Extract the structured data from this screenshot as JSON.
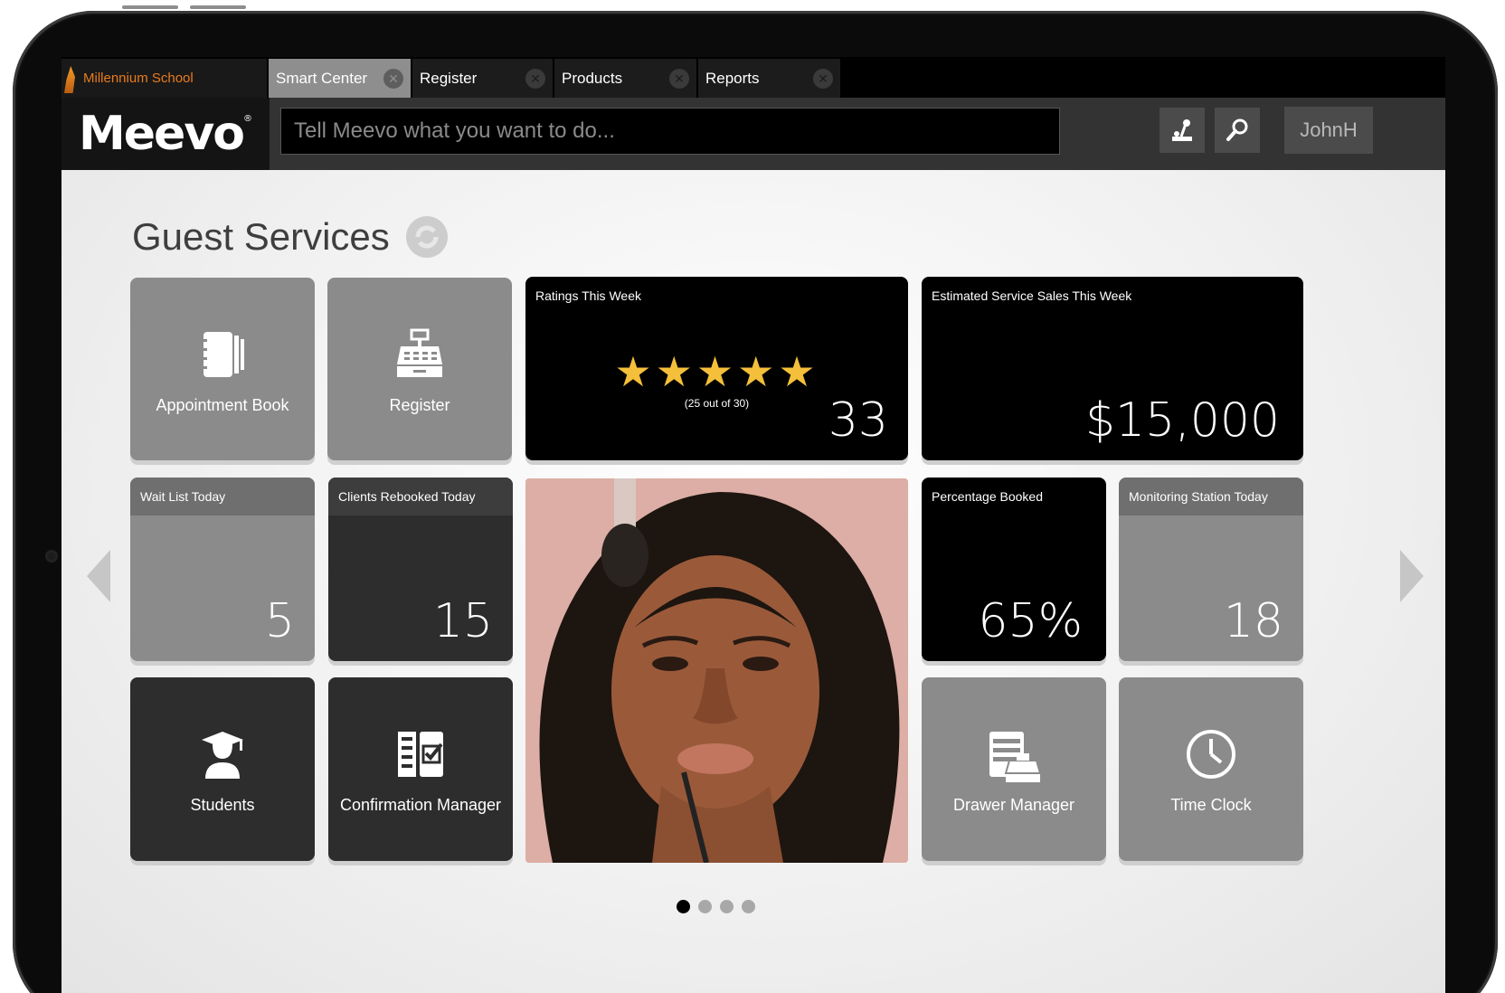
{
  "tabs": {
    "brand": "Millennium School",
    "items": [
      {
        "label": "Smart Center"
      },
      {
        "label": "Register"
      },
      {
        "label": "Products"
      },
      {
        "label": "Reports"
      }
    ]
  },
  "header": {
    "logo": "Meevo",
    "search_placeholder": "Tell Meevo what you want to do...",
    "user": "JohnH"
  },
  "page": {
    "title": "Guest Services",
    "pager": {
      "count": 4,
      "active": 1
    }
  },
  "tiles": {
    "appointment_book": "Appointment Book",
    "register": "Register",
    "ratings": {
      "title": "Ratings This Week",
      "stars": 5,
      "detail": "(25 out of 30)",
      "value": "33"
    },
    "sales": {
      "title": "Estimated Service Sales This Week",
      "value": "$15,000"
    },
    "wait_list": {
      "title": "Wait List Today",
      "value": "5"
    },
    "rebooked": {
      "title": "Clients Rebooked Today",
      "value": "15"
    },
    "pct_booked": {
      "title": "Percentage Booked",
      "value": "65%"
    },
    "monitoring": {
      "title": "Monitoring Station Today",
      "value": "18"
    },
    "students": "Students",
    "confirmation": "Confirmation Manager",
    "drawer": "Drawer Manager",
    "time_clock": "Time Clock"
  },
  "colors": {
    "accent": "#e87c1d",
    "star": "#f4bf3a",
    "tile_light": "#8b8b8b",
    "tile_dark": "#2d2d2d"
  }
}
